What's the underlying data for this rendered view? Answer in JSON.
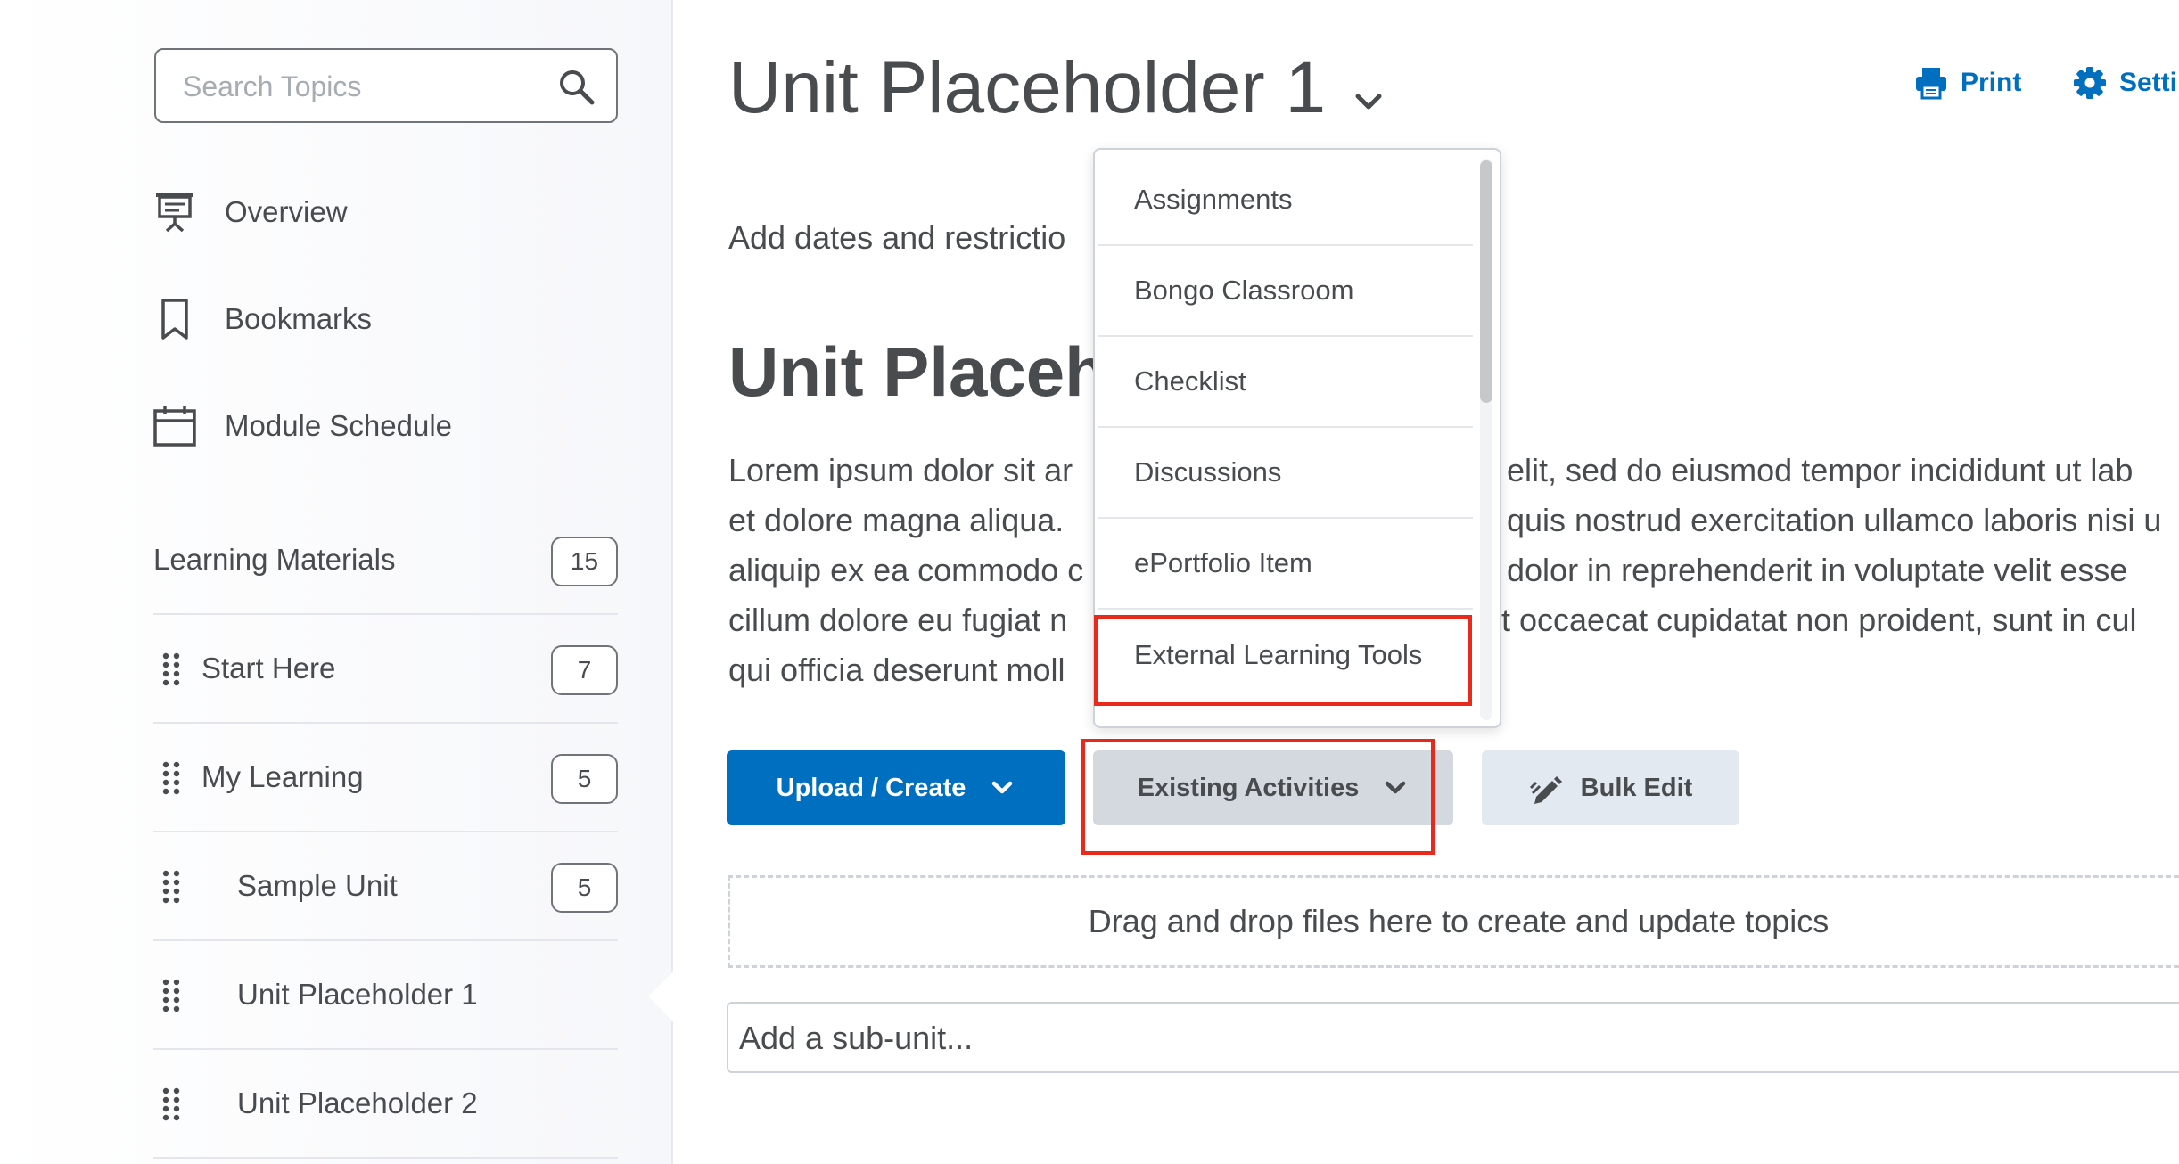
{
  "sidebar": {
    "search": {
      "placeholder": "Search Topics"
    },
    "nav": [
      {
        "label": "Overview",
        "icon": "presentation-icon"
      },
      {
        "label": "Bookmarks",
        "icon": "bookmark-icon"
      },
      {
        "label": "Module Schedule",
        "icon": "calendar-icon"
      }
    ],
    "tree": [
      {
        "label": "Learning Materials",
        "count": "15"
      },
      {
        "label": "Start Here",
        "count": "7"
      },
      {
        "label": "My Learning",
        "count": "5"
      },
      {
        "label": "Sample Unit",
        "count": "5"
      },
      {
        "label": "Unit Placeholder 1",
        "count": ""
      },
      {
        "label": "Unit Placeholder 2",
        "count": ""
      }
    ]
  },
  "main": {
    "title": "Unit Placeholder 1",
    "actions": {
      "print": "Print",
      "settings": "Settir"
    },
    "dates_link": "Add dates and restrictio",
    "heading": "Unit Placeho",
    "lorem": [
      "Lorem ipsum dolor sit ar",
      "et dolore magna aliqua.",
      "aliquip ex ea commodo c",
      "cillum dolore eu fugiat n",
      "qui officia deserunt moll"
    ],
    "lorem_right": [
      "elit, sed do eiusmod tempor incididunt ut lab",
      "quis nostrud exercitation ullamco laboris nisi u",
      "dolor in reprehenderit in voluptate velit esse",
      "t occaecat cupidatat non proident, sunt in cul"
    ],
    "buttons": {
      "upload": "Upload / Create",
      "existing": "Existing Activities",
      "bulk": "Bulk Edit"
    },
    "dropzone": "Drag and drop files here to create and update topics",
    "subunit_placeholder": "Add a sub-unit..."
  },
  "dropdown": {
    "items": [
      "Assignments",
      "Bongo Classroom",
      "Checklist",
      "Discussions",
      "ePortfolio Item",
      "External Learning Tools"
    ],
    "highlighted": "External Learning Tools"
  },
  "colors": {
    "primary": "#006fbf",
    "text": "#494c4e",
    "highlight": "#e8291c",
    "secondary_button": "#d4d9e0",
    "tertiary_button": "#e3e9f1"
  }
}
